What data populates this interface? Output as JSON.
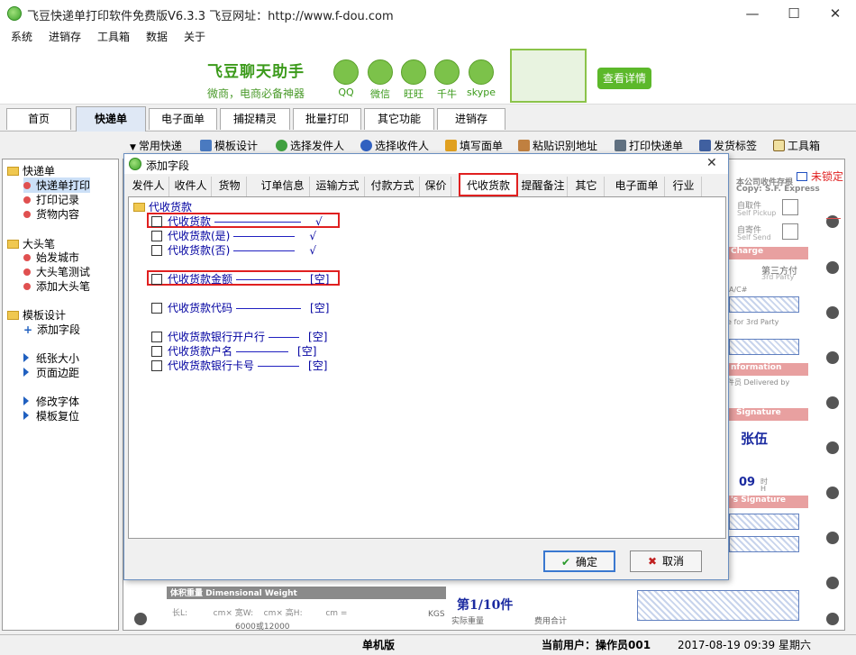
{
  "window": {
    "title": "飞豆快递单打印软件免费版V6.3.3   飞豆网址：http://www.f-dou.com",
    "minimize": "—",
    "maximize": "☐",
    "close": "✕"
  },
  "menu": [
    "系统",
    "进销存",
    "工具箱",
    "数据",
    "关于"
  ],
  "banner": {
    "title": "飞豆聊天助手",
    "subtitle": "微商，电商必备神器",
    "icons": [
      "QQ",
      "微信",
      "旺旺",
      "千牛",
      "skype"
    ],
    "details_button": "查看详情"
  },
  "main_tabs": [
    "首页",
    "快递单",
    "电子面单",
    "捕捉精灵",
    "批量打印",
    "其它功能",
    "进销存"
  ],
  "toolbar": [
    "常用快递",
    "模板设计",
    "选择发件人",
    "选择收件人",
    "填写面单",
    "粘贴识别地址",
    "打印快递单",
    "发货标签",
    "工具箱"
  ],
  "tree": {
    "groups": [
      {
        "label": "快递单",
        "items": [
          "快递单打印",
          "打印记录",
          "货物内容"
        ]
      },
      {
        "label": "大头笔",
        "items": [
          "始发城市",
          "大头笔测试",
          "添加大头笔"
        ]
      },
      {
        "label": "模板设计",
        "items": [
          "添加字段",
          "纸张大小",
          "页面边距",
          "修改字体",
          "模板复位"
        ]
      }
    ]
  },
  "paper": {
    "lock_status": "未锁定",
    "name": "张伍",
    "page_counter": "第1/10件",
    "volume_label": "体积重量 Dimensional Weight",
    "volume_formula": "6000或12000",
    "kgs": "KGS",
    "actual_weight": "实际重量",
    "total_charge": "费用合计",
    "company_copy": "本公司收件存根",
    "copy_en": "Copy: S.F. Express",
    "self_pickup": "自取件",
    "self_pickup_en": "Self Pickup",
    "self_send": "自寄件",
    "self_send_en": "Self Send",
    "charge": "Charge",
    "third_party": "第三方付",
    "third_party_en": "3rd Party",
    "for_3rd_party": "e for 3rd Party",
    "information": "nformation",
    "delivered_by": "件员 Delivered by",
    "signature": "Signature",
    "s_signature": "'s Signature",
    "number_09": "09",
    "shi": "时",
    "h": "H",
    "ac": "A/C#",
    "long": "长L:",
    "cm_x": "cm×",
    "width": "宽W:",
    "height": "高H:",
    "cm_eq": "cm ="
  },
  "dialog": {
    "title": "添加字段",
    "close": "✕",
    "tabs": [
      "发件人",
      "收件人",
      "货物",
      "订单信息",
      "运输方式",
      "付款方式",
      "保价",
      "代收货款",
      "提醒备注",
      "其它",
      "电子面单",
      "行业"
    ],
    "active_tab": "代收货款",
    "folder": "代收货款",
    "fields": [
      {
        "label": "代收货款",
        "value": "√"
      },
      {
        "label": "代收货款(是)",
        "value": "√"
      },
      {
        "label": "代收货款(否)",
        "value": "√"
      },
      {
        "label": "代收货款金额",
        "value": "[空]"
      },
      {
        "label": "代收货款代码",
        "value": "[空]"
      },
      {
        "label": "代收货款银行开户行",
        "value": "[空]"
      },
      {
        "label": "代收货款户名",
        "value": "[空]"
      },
      {
        "label": "代收货款银行卡号",
        "value": "[空]"
      }
    ],
    "ok": "确定",
    "cancel": "取消"
  },
  "status": {
    "mode": "单机版",
    "user": "当前用户：操作员001",
    "datetime": "2017-08-19 09:39 星期六"
  },
  "colors": {
    "accent_green": "#3b9a1a",
    "highlight_red": "#e02020",
    "field_blue": "#0000a0",
    "arrow_red": "#e81818"
  }
}
